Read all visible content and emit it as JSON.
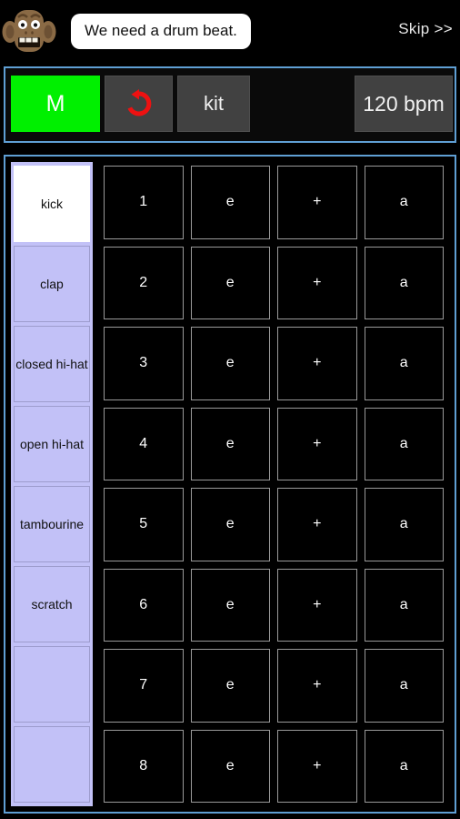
{
  "header": {
    "avatar_icon": "monkey-avatar-icon",
    "bubble_text": "We need a drum beat.",
    "skip_label": "Skip >>"
  },
  "toolbar": {
    "metronome_label": "M",
    "metronome_color": "#00f000",
    "undo_icon": "undo-rotate-ccw-icon",
    "undo_icon_color": "#ee1111",
    "kit_label": "kit",
    "tempo_label": "120 bpm",
    "tempo_value": 120,
    "tempo_unit": "bpm"
  },
  "sequencer": {
    "panel_border_color": "#5f9fd4",
    "instruments": [
      {
        "label": "kick",
        "selected": true
      },
      {
        "label": "clap",
        "selected": false
      },
      {
        "label": "closed hi-hat",
        "selected": false
      },
      {
        "label": "open hi-hat",
        "selected": false
      },
      {
        "label": "tambourine",
        "selected": false
      },
      {
        "label": "scratch",
        "selected": false
      },
      {
        "label": "",
        "selected": false
      },
      {
        "label": "",
        "selected": false
      }
    ],
    "rows": [
      {
        "beat": "1",
        "steps": [
          "1",
          "e",
          "+",
          "a"
        ]
      },
      {
        "beat": "2",
        "steps": [
          "2",
          "e",
          "+",
          "a"
        ]
      },
      {
        "beat": "3",
        "steps": [
          "3",
          "e",
          "+",
          "a"
        ]
      },
      {
        "beat": "4",
        "steps": [
          "4",
          "e",
          "+",
          "a"
        ]
      },
      {
        "beat": "5",
        "steps": [
          "5",
          "e",
          "+",
          "a"
        ]
      },
      {
        "beat": "6",
        "steps": [
          "6",
          "e",
          "+",
          "a"
        ]
      },
      {
        "beat": "7",
        "steps": [
          "7",
          "e",
          "+",
          "a"
        ]
      },
      {
        "beat": "8",
        "steps": [
          "8",
          "e",
          "+",
          "a"
        ]
      }
    ]
  }
}
